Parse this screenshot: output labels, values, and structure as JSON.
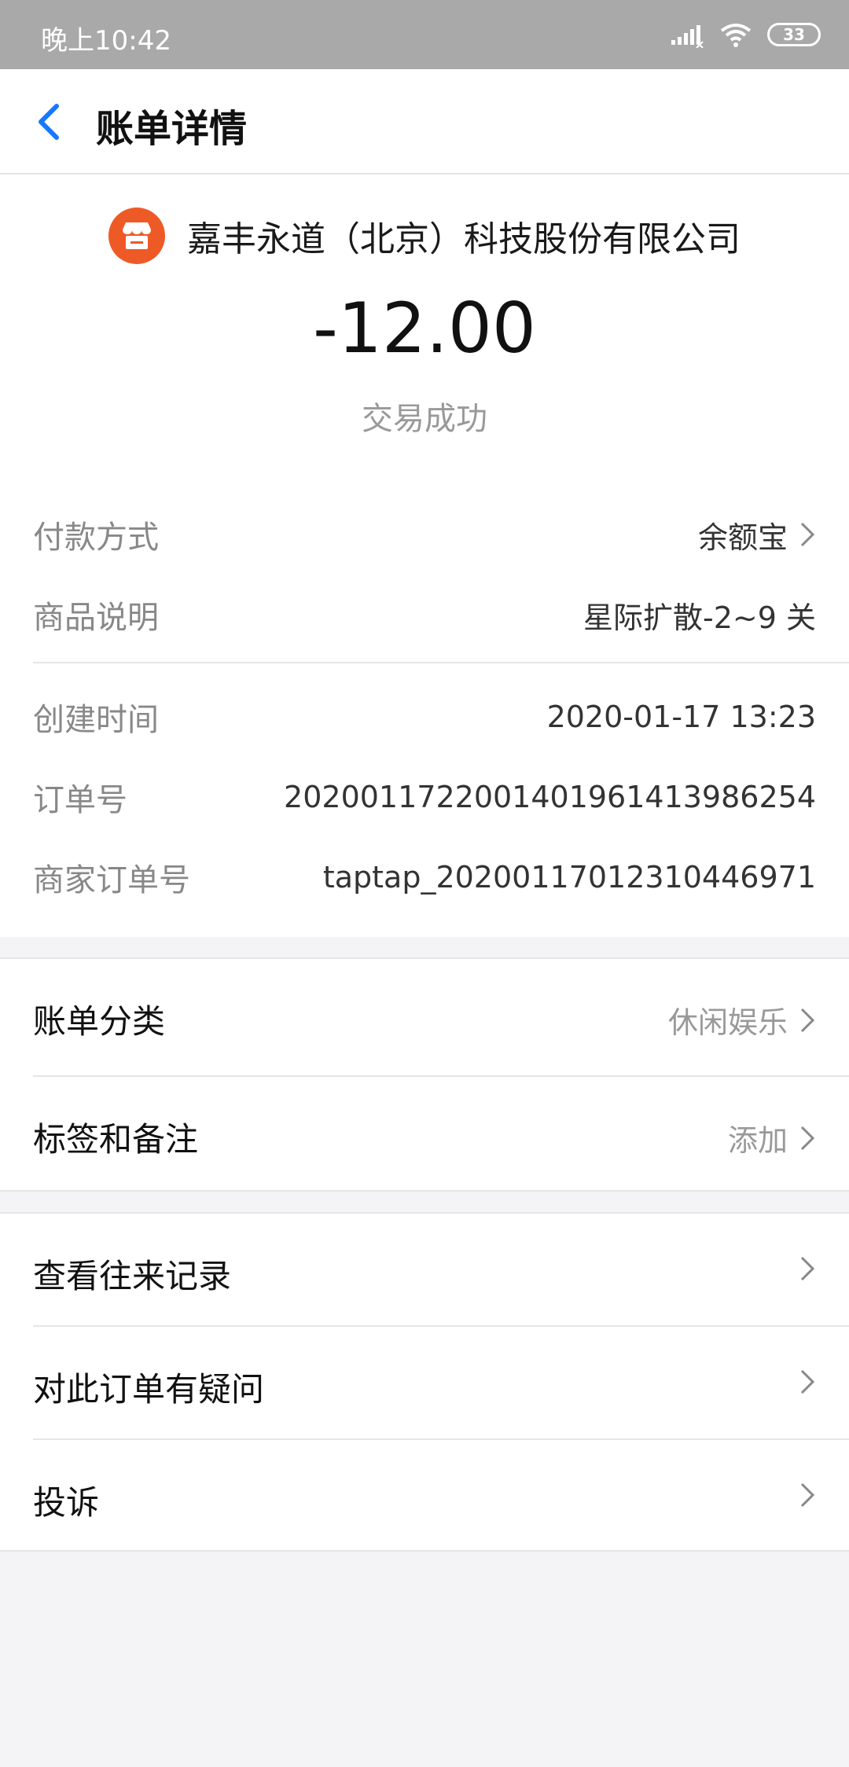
{
  "status_bar": {
    "time": "晚上10:42",
    "battery": "33"
  },
  "navbar": {
    "title": "账单详情"
  },
  "header": {
    "merchant": "嘉丰永道（北京）科技股份有限公司",
    "amount": "-12.00",
    "status": "交易成功"
  },
  "details": [
    {
      "label": "付款方式",
      "value": "余额宝"
    },
    {
      "label": "商品说明",
      "value": "星际扩散-2~9 关"
    }
  ],
  "order_info": [
    {
      "label": "创建时间",
      "value": "2020-01-17 13:23"
    },
    {
      "label": "订单号",
      "value": "2020011722001401961413986254"
    },
    {
      "label": "商家订单号",
      "value": "taptap_20200117012310446971"
    }
  ],
  "category_card": [
    {
      "label": "账单分类",
      "value": "休闲娱乐"
    },
    {
      "label": "标签和备注",
      "value": "添加"
    }
  ],
  "actions_card": [
    {
      "label": "查看往来记录"
    },
    {
      "label": "对此订单有疑问"
    },
    {
      "label": "投诉"
    }
  ],
  "colors": {
    "accent": "#1677ff",
    "merchant_logo": "#ee5a26",
    "statusbar": "#a9a9a9"
  }
}
